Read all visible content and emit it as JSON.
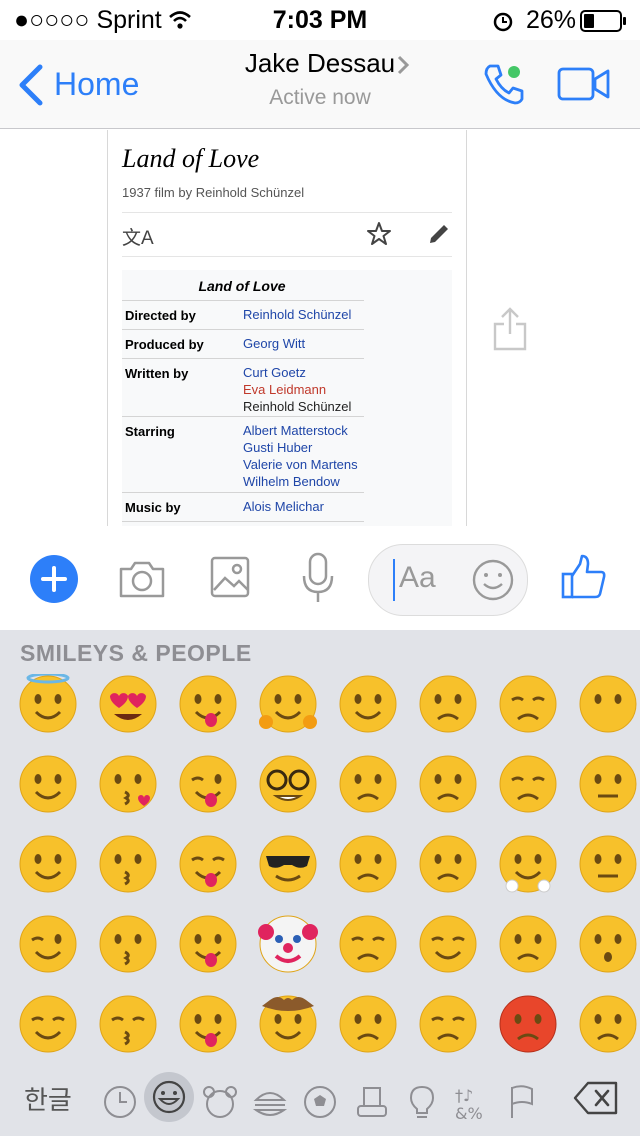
{
  "status_bar": {
    "carrier": "●○○○○ Sprint",
    "time": "7:03 PM",
    "battery": "26%"
  },
  "header": {
    "back_label": "Home",
    "contact_name": "Jake Dessau",
    "contact_status": "Active now"
  },
  "article": {
    "title": "Land of Love",
    "description": "1937 film by Reinhold Schünzel",
    "infobox_title": "Land of Love",
    "rows": [
      {
        "label": "Directed by",
        "values": [
          "Reinhold Schünzel"
        ]
      },
      {
        "label": "Produced by",
        "values": [
          "Georg Witt"
        ]
      },
      {
        "label": "Written by",
        "values": [
          "Curt Goetz",
          "Eva Leidmann",
          "Reinhold Schünzel"
        ]
      },
      {
        "label": "Starring",
        "values": [
          "Albert Matterstock",
          "Gusti Huber",
          "Valerie von Martens",
          "Wilhelm Bendow"
        ]
      },
      {
        "label": "Music by",
        "values": [
          "Alois Melichar"
        ]
      }
    ]
  },
  "composer": {
    "placeholder": "Aa"
  },
  "keyboard": {
    "category": "SMILEYS & PEOPLE",
    "lang_key": "한글"
  },
  "icons": {
    "back": "chevron-left-icon",
    "call": "phone-icon",
    "video": "video-icon",
    "share": "share-icon",
    "plus": "plus-icon",
    "camera": "camera-icon",
    "gallery": "image-icon",
    "mic": "microphone-icon",
    "emoji": "smiley-icon",
    "like": "thumbs-up-icon",
    "backspace": "backspace-icon"
  },
  "colors": {
    "accent": "#2d7ff9",
    "online": "#44c767",
    "link": "#1f46a8",
    "redlink": "#c0392b"
  }
}
